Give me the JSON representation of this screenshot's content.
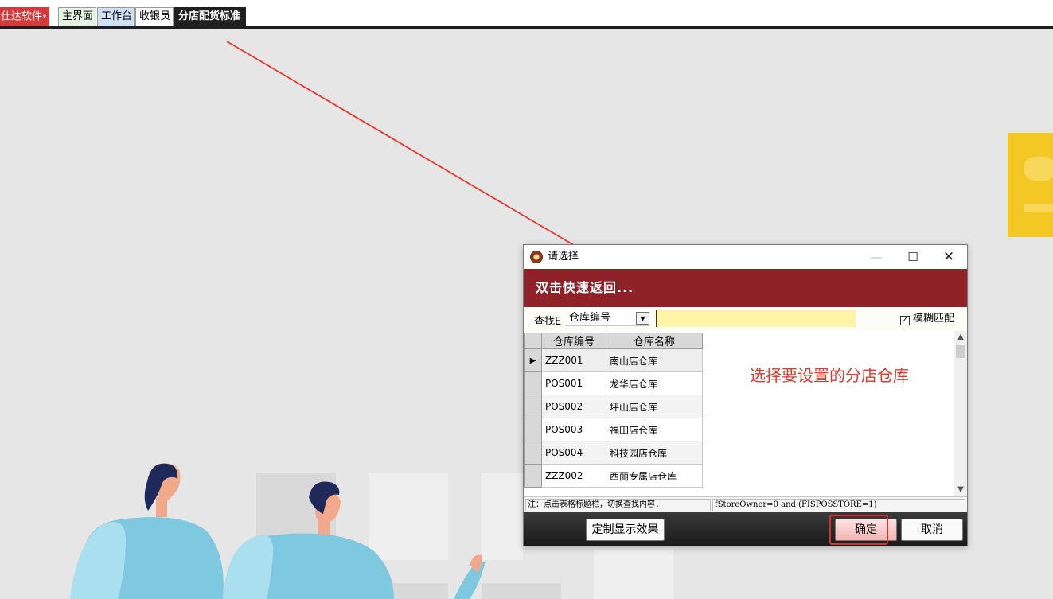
{
  "topbar": {
    "brand": "仕达软件",
    "tabs": [
      {
        "label": "主界面"
      },
      {
        "label": "工作台"
      },
      {
        "label": "收银员"
      },
      {
        "label": "分店配货标准"
      }
    ]
  },
  "dialog": {
    "title": "请选择",
    "banner": "双击快速返回...",
    "search": {
      "label": "查找E",
      "field": "仓库编号",
      "value": "",
      "fuzzy_label": "模糊匹配",
      "fuzzy_checked": true
    },
    "grid": {
      "columns": [
        "仓库编号",
        "仓库名称"
      ],
      "rows": [
        {
          "code": "ZZZ001",
          "name": "南山店仓库"
        },
        {
          "code": "POS001",
          "name": "龙华店仓库"
        },
        {
          "code": "POS002",
          "name": "坪山店仓库"
        },
        {
          "code": "POS003",
          "name": "福田店仓库"
        },
        {
          "code": "POS004",
          "name": "科技园店仓库"
        },
        {
          "code": "ZZZ002",
          "name": "西丽专属店仓库"
        }
      ]
    },
    "annotation": "选择要设置的分店仓库",
    "status": {
      "note": "注：点击表格标题栏，切换查找内容.",
      "filter": "fStoreOwner=0 and (FISPOSSTORE=1)"
    },
    "buttons": {
      "custom": "定制显示效果",
      "ok": "确定",
      "cancel": "取消"
    }
  },
  "colors": {
    "banner": "#8f2228",
    "annotation": "#e8362a",
    "brand": "#d33b3b",
    "highlight": "#e8282c"
  }
}
